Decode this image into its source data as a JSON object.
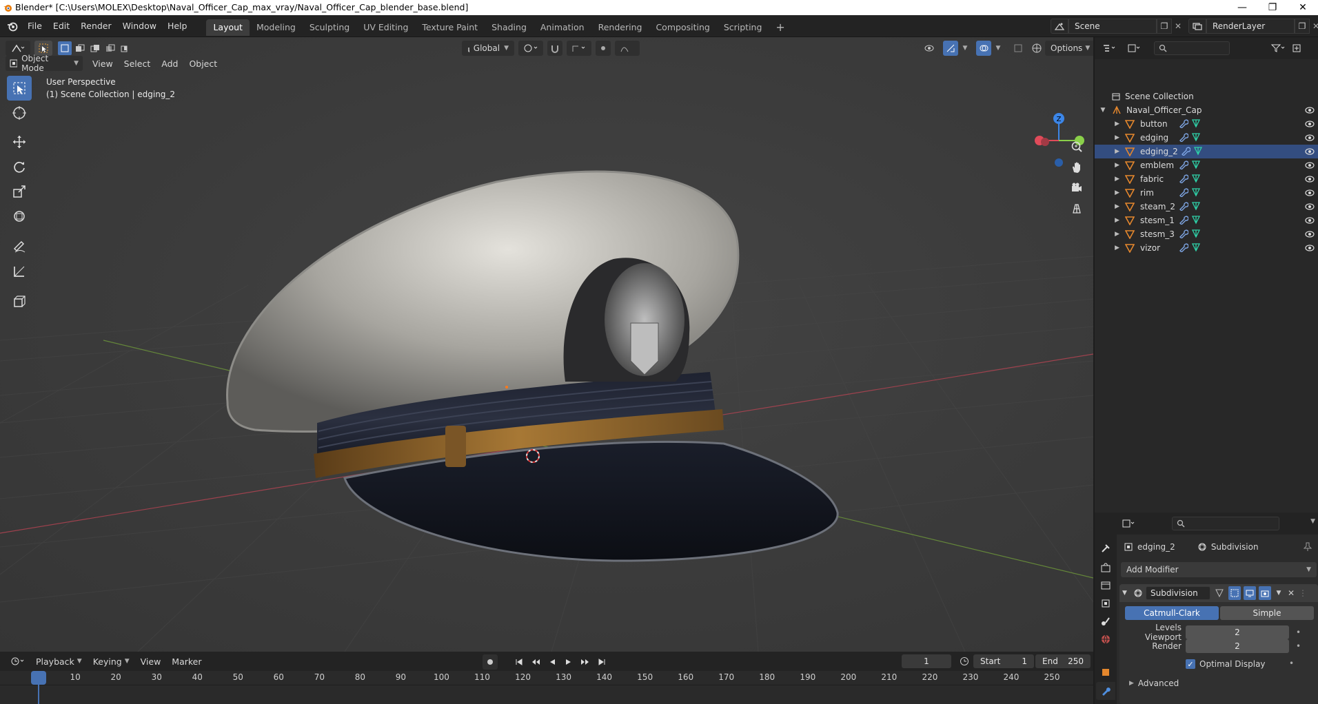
{
  "titlebar": {
    "title": "Blender* [C:\\Users\\MOLEX\\Desktop\\Naval_Officer_Cap_max_vray/Naval_Officer_Cap_blender_base.blend]"
  },
  "menu": {
    "file": "File",
    "edit": "Edit",
    "render": "Render",
    "window": "Window",
    "help": "Help"
  },
  "workspaces": [
    "Layout",
    "Modeling",
    "Sculpting",
    "UV Editing",
    "Texture Paint",
    "Shading",
    "Animation",
    "Rendering",
    "Compositing",
    "Scripting"
  ],
  "scene": {
    "name": "Scene",
    "view_layer": "RenderLayer"
  },
  "viewport_header": {
    "mode": "Object Mode",
    "view": "View",
    "select": "Select",
    "add": "Add",
    "object": "Object",
    "transform_orientation": "Global",
    "options": "Options"
  },
  "viewport_info": {
    "line1": "User Perspective",
    "line2": "(1) Scene Collection | edging_2"
  },
  "gizmo": {
    "z_label": "Z"
  },
  "outliner": {
    "root": "Scene Collection",
    "collection": "Naval_Officer_Cap",
    "objects": [
      {
        "name": "button",
        "selected": false
      },
      {
        "name": "edging",
        "selected": false
      },
      {
        "name": "edging_2",
        "selected": true
      },
      {
        "name": "emblem",
        "selected": false
      },
      {
        "name": "fabric",
        "selected": false
      },
      {
        "name": "rim",
        "selected": false
      },
      {
        "name": "steam_2",
        "selected": false
      },
      {
        "name": "stesm_1",
        "selected": false
      },
      {
        "name": "stesm_3",
        "selected": false
      },
      {
        "name": "vizor",
        "selected": false
      }
    ]
  },
  "properties": {
    "object_name": "edging_2",
    "modifier_breadcrumb": "Subdivision",
    "add_modifier": "Add Modifier",
    "modifier_name": "Subdivision",
    "mode_catmull": "Catmull-Clark",
    "mode_simple": "Simple",
    "levels_viewport_label": "Levels Viewport",
    "levels_viewport_value": "2",
    "render_label": "Render",
    "render_value": "2",
    "optimal_display": "Optimal Display",
    "advanced": "Advanced"
  },
  "timeline": {
    "playback": "Playback",
    "keying": "Keying",
    "view": "View",
    "marker": "Marker",
    "current_frame": "1",
    "start_label": "Start",
    "start_value": "1",
    "end_label": "End",
    "end_value": "250",
    "ticks": [
      "1",
      "10",
      "20",
      "30",
      "40",
      "50",
      "60",
      "70",
      "80",
      "90",
      "100",
      "110",
      "120",
      "130",
      "140",
      "150",
      "160",
      "170",
      "180",
      "190",
      "200",
      "210",
      "220",
      "230",
      "240",
      "250"
    ]
  },
  "colors": {
    "accent": "#4772b3",
    "selected_row": "#334d80",
    "object_icon": "#e5872d",
    "mesh_icon": "#2fd1a8",
    "modifier_icon": "#7fa7e6",
    "x_axis": "#e04b5a",
    "y_axis": "#8ad04a",
    "z_axis": "#3c86e8"
  }
}
